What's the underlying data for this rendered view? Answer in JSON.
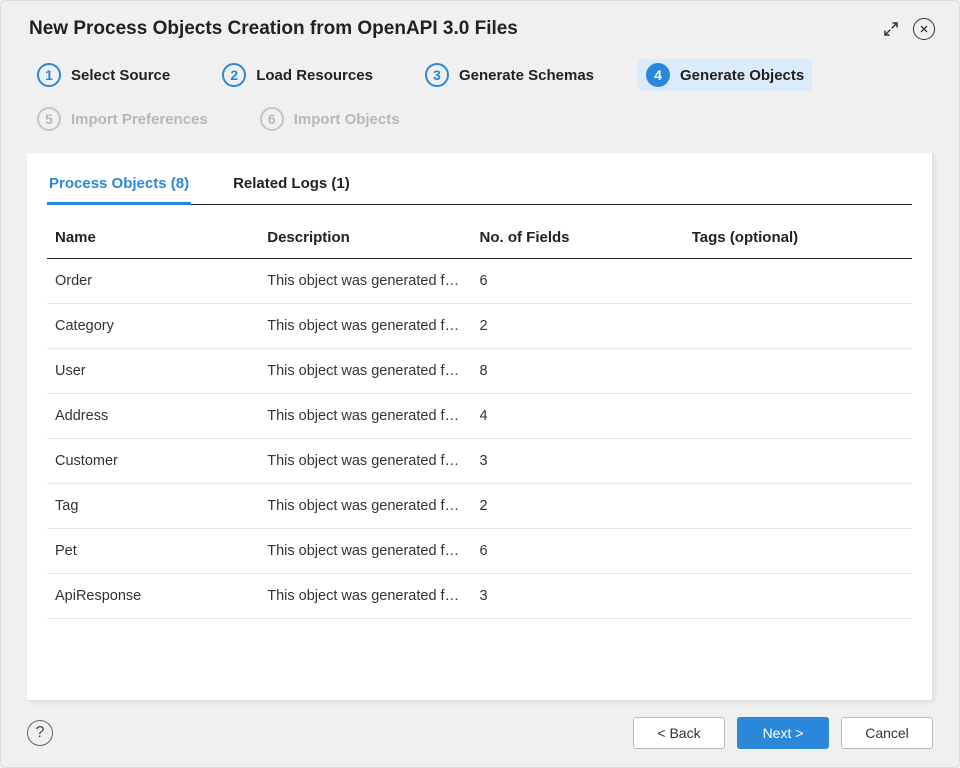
{
  "header": {
    "title": "New Process Objects Creation from OpenAPI 3.0 Files"
  },
  "steps": [
    {
      "num": "1",
      "label": "Select Source",
      "state": "done"
    },
    {
      "num": "2",
      "label": "Load Resources",
      "state": "done"
    },
    {
      "num": "3",
      "label": "Generate Schemas",
      "state": "done"
    },
    {
      "num": "4",
      "label": "Generate Objects",
      "state": "current"
    },
    {
      "num": "5",
      "label": "Import Preferences",
      "state": "pending"
    },
    {
      "num": "6",
      "label": "Import Objects",
      "state": "pending"
    }
  ],
  "tabs": {
    "process_objects": "Process Objects (8)",
    "related_logs": "Related Logs (1)"
  },
  "table": {
    "headers": {
      "name": "Name",
      "description": "Description",
      "fields": "No. of Fields",
      "tags": "Tags (optional)"
    },
    "rows": [
      {
        "name": "Order",
        "description": "This object was generated fro...",
        "fields": "6",
        "tags": ""
      },
      {
        "name": "Category",
        "description": "This object was generated fro...",
        "fields": "2",
        "tags": ""
      },
      {
        "name": "User",
        "description": "This object was generated fro...",
        "fields": "8",
        "tags": ""
      },
      {
        "name": "Address",
        "description": "This object was generated fro...",
        "fields": "4",
        "tags": ""
      },
      {
        "name": "Customer",
        "description": "This object was generated fro...",
        "fields": "3",
        "tags": ""
      },
      {
        "name": "Tag",
        "description": "This object was generated fro...",
        "fields": "2",
        "tags": ""
      },
      {
        "name": "Pet",
        "description": "This object was generated fro...",
        "fields": "6",
        "tags": ""
      },
      {
        "name": "ApiResponse",
        "description": "This object was generated fro...",
        "fields": "3",
        "tags": ""
      }
    ]
  },
  "footer": {
    "back": "< Back",
    "next": "Next >",
    "cancel": "Cancel",
    "help": "?"
  }
}
